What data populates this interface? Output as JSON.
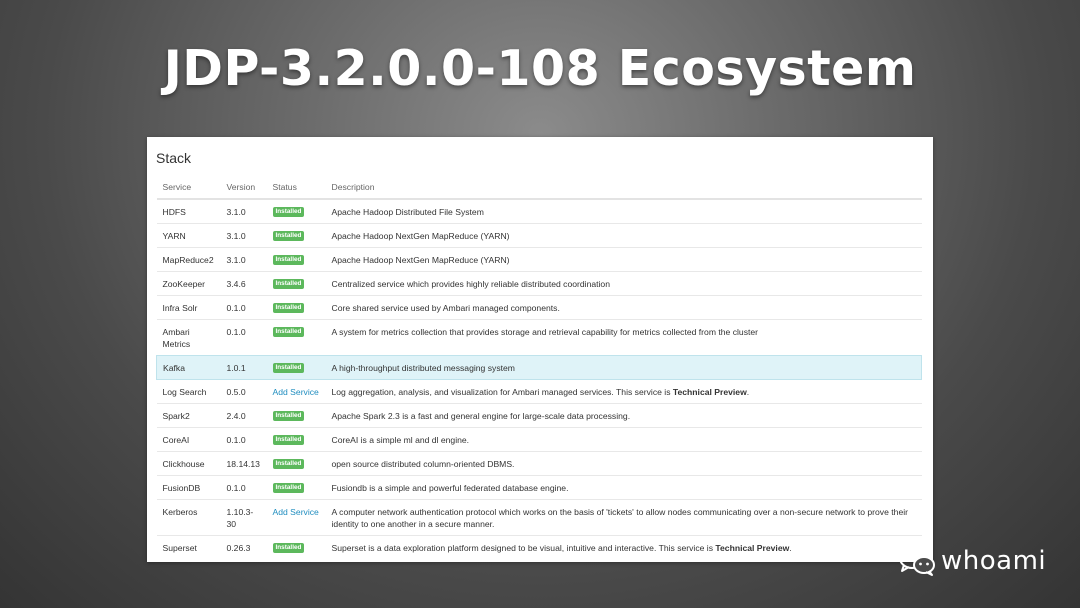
{
  "slide": {
    "title": "JDP-3.2.0.0-108 Ecosystem"
  },
  "stack": {
    "title": "Stack",
    "columns": {
      "service": "Service",
      "version": "Version",
      "status": "Status",
      "description": "Description"
    },
    "rows": [
      {
        "service": "HDFS",
        "version": "3.1.0",
        "status": "Installed",
        "description": "Apache Hadoop Distributed File System"
      },
      {
        "service": "YARN",
        "version": "3.1.0",
        "status": "Installed",
        "description": "Apache Hadoop NextGen MapReduce (YARN)"
      },
      {
        "service": "MapReduce2",
        "version": "3.1.0",
        "status": "Installed",
        "description": "Apache Hadoop NextGen MapReduce (YARN)"
      },
      {
        "service": "ZooKeeper",
        "version": "3.4.6",
        "status": "Installed",
        "description": "Centralized service which provides highly reliable distributed coordination"
      },
      {
        "service": "Infra Solr",
        "version": "0.1.0",
        "status": "Installed",
        "description": "Core shared service used by Ambari managed components."
      },
      {
        "service": "Ambari Metrics",
        "version": "0.1.0",
        "status": "Installed",
        "description": "A system for metrics collection that provides storage and retrieval capability for metrics collected from the cluster"
      },
      {
        "service": "Kafka",
        "version": "1.0.1",
        "status": "Installed",
        "description": "A high-throughput distributed messaging system"
      },
      {
        "service": "Log Search",
        "version": "0.5.0",
        "status": "Add Service",
        "description": "Log aggregation, analysis, and visualization for Ambari managed services. This service is ",
        "description_bold": "Technical Preview",
        "description_after": "."
      },
      {
        "service": "Spark2",
        "version": "2.4.0",
        "status": "Installed",
        "description": "Apache Spark 2.3 is a fast and general engine for large-scale data processing."
      },
      {
        "service": "CoreAI",
        "version": "0.1.0",
        "status": "Installed",
        "description": "CoreAI is a simple ml and dl engine."
      },
      {
        "service": "Clickhouse",
        "version": "18.14.13",
        "status": "Installed",
        "description": "open source distributed column-oriented DBMS."
      },
      {
        "service": "FusionDB",
        "version": "0.1.0",
        "status": "Installed",
        "description": "Fusiondb is a simple and powerful federated database engine."
      },
      {
        "service": "Kerberos",
        "version": "1.10.3-30",
        "status": "Add Service",
        "description": "A computer network authentication protocol which works on the basis of 'tickets' to allow nodes communicating over a non-secure network to prove their identity to one another in a secure manner."
      },
      {
        "service": "Superset",
        "version": "0.26.3",
        "status": "Installed",
        "description": "Superset is a data exploration platform designed to be visual, intuitive and interactive. This service is ",
        "description_bold": "Technical Preview",
        "description_after": "."
      }
    ]
  },
  "watermark": {
    "icon": "wechat-icon",
    "text": "whoami"
  },
  "colors": {
    "installed_badge": "#5cb85c",
    "link": "#1f8dbf",
    "highlight_row": "#dff3f8"
  }
}
